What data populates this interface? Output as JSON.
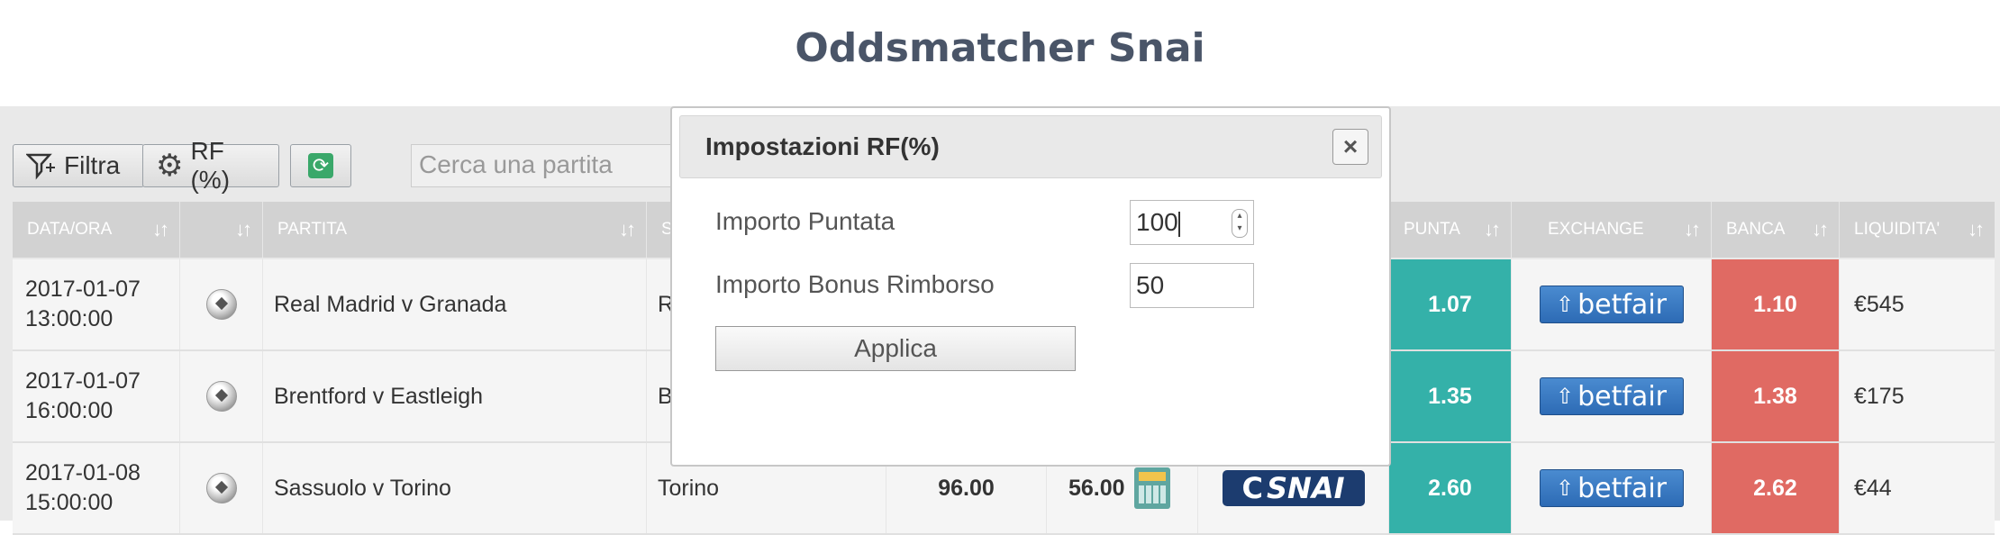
{
  "page": {
    "title": "Oddsmatcher Snai"
  },
  "toolbar": {
    "filter_label": "Filtra",
    "rf_label": "RF (%)",
    "search_placeholder": "Cerca una partita"
  },
  "table": {
    "headers": {
      "date": "DATA/ORA",
      "sport": "",
      "match": "PARTITA",
      "selection": "S",
      "punta": "PUNTA",
      "exchange": "EXCHANGE",
      "banca": "BANCA",
      "liquidity": "LIQUIDITA'"
    },
    "rows": [
      {
        "date_line1": "2017-01-07",
        "date_line2": "13:00:00",
        "match": "Real Madrid v Granada",
        "selection": "R",
        "value1": "",
        "value2": "",
        "bookmaker_logo": "",
        "punta": "1.07",
        "exchange_logo": "betfair",
        "banca": "1.10",
        "liquidity": "€545"
      },
      {
        "date_line1": "2017-01-07",
        "date_line2": "16:00:00",
        "match": "Brentford v Eastleigh",
        "selection": "B",
        "value1": "",
        "value2": "",
        "bookmaker_logo": "",
        "punta": "1.35",
        "exchange_logo": "betfair",
        "banca": "1.38",
        "liquidity": "€175"
      },
      {
        "date_line1": "2017-01-08",
        "date_line2": "15:00:00",
        "match": "Sassuolo v Torino",
        "selection": "Torino",
        "value1": "96.00",
        "value2": "56.00",
        "bookmaker_logo": "SNAI",
        "punta": "2.60",
        "exchange_logo": "betfair",
        "banca": "2.62",
        "liquidity": "€44"
      }
    ]
  },
  "modal": {
    "title": "Impostazioni RF(%)",
    "close_label": "×",
    "stake_label": "Importo Puntata",
    "stake_value": "100",
    "bonus_label": "Importo Bonus Rimborso",
    "bonus_value": "50",
    "apply_label": "Applica"
  },
  "colors": {
    "punta": "#34b1a9",
    "banca": "#e06a63",
    "title": "#4a5568"
  }
}
